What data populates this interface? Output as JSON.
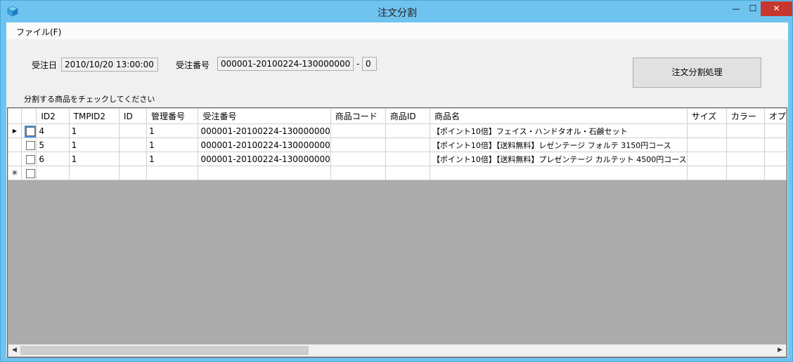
{
  "window": {
    "title": "注文分割",
    "close_glyph": "✕",
    "min_glyph": "—",
    "max_glyph": "☐"
  },
  "menu": {
    "file": "ファイル(F)"
  },
  "form": {
    "order_date_label": "受注日",
    "order_date_value": "2010/10/20 13:00:00",
    "order_no_label": "受注番号",
    "order_no_value": "000001-20100224-130000000",
    "order_no_sep": "-",
    "order_no_suffix": "0",
    "split_button": "注文分割処理",
    "instruction": "分割する商品をチェックしてください"
  },
  "grid": {
    "columns": [
      "",
      "",
      "ID2",
      "TMPID2",
      "ID",
      "管理番号",
      "受注番号",
      "商品コード",
      "商品ID",
      "商品名",
      "サイズ",
      "カラー",
      "オプ"
    ],
    "current_row_glyph": "▶",
    "new_row_glyph": "✳",
    "rows": [
      {
        "id2": "4",
        "tmpid2": "1",
        "id": "",
        "kanri": "1",
        "juchu": "000001-20100224-130000000",
        "code": "",
        "shohin_id": "",
        "name": "【ポイント10倍】フェイス・ハンドタオル・石鹸セット",
        "size": "",
        "color": "",
        "opt": ""
      },
      {
        "id2": "5",
        "tmpid2": "1",
        "id": "",
        "kanri": "1",
        "juchu": "000001-20100224-130000000",
        "code": "",
        "shohin_id": "",
        "name": "【ポイント10倍】【送料無料】レゼンテージ フォルテ 3150円コース",
        "size": "",
        "color": "",
        "opt": ""
      },
      {
        "id2": "6",
        "tmpid2": "1",
        "id": "",
        "kanri": "1",
        "juchu": "000001-20100224-130000000",
        "code": "",
        "shohin_id": "",
        "name": "【ポイント10倍】【送料無料】プレゼンテージ カルテット 4500円コース",
        "size": "",
        "color": "",
        "opt": ""
      }
    ]
  },
  "scroll": {
    "left": "◀",
    "right": "▶"
  }
}
